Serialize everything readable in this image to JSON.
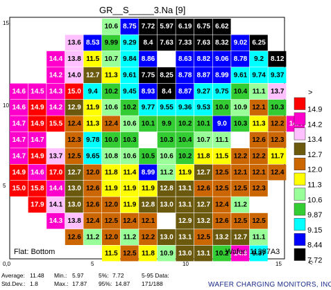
{
  "chart_data": {
    "type": "heatmap",
    "title": "GR__S_____3.Na    [9]",
    "xlim": [
      0,
      15
    ],
    "ylim": [
      0,
      15
    ],
    "x_ticks": [
      "0,0",
      "5",
      "10",
      "15"
    ],
    "y_ticks": [
      "15",
      "10",
      "5"
    ],
    "grid": false,
    "flat_label": "Flat: Bottom",
    "wafer_label": "Wafer: 11387A3",
    "legend": {
      "placement": "right",
      "top_marker": ">",
      "bottom_marker": "<",
      "bins": [
        {
          "label": "14.9",
          "color": "#ff0000"
        },
        {
          "label": "14.2",
          "color": "#ff00cc"
        },
        {
          "label": "13.4",
          "color": "#ffc0ff"
        },
        {
          "label": "12.7",
          "color": "#6b5a0e"
        },
        {
          "label": "12.0",
          "color": "#cc6600"
        },
        {
          "label": "11.3",
          "color": "#ffff00"
        },
        {
          "label": "10.6",
          "color": "#99ff99"
        },
        {
          "label": "9.87",
          "color": "#33cc33"
        },
        {
          "label": "9.15",
          "color": "#00ffff"
        },
        {
          "label": "8.44",
          "color": "#0000ff"
        },
        {
          "label": "7.72",
          "color": "#000000"
        }
      ]
    },
    "rows": [
      {
        "start": 5,
        "values": [
          "10.6",
          "8.75",
          "7.72",
          "5.97",
          "6.19",
          "6.75",
          "6.62"
        ]
      },
      {
        "start": 3,
        "values": [
          "13.6",
          "8.53",
          "9.99",
          "9.29",
          "8.4",
          "7.63",
          "7.33",
          "7.63",
          "8.32",
          "9.02",
          "6.25"
        ]
      },
      {
        "start": 2,
        "values": [
          "14.4",
          "13.8",
          "11.5",
          "10.7",
          "9.84",
          "8.86",
          "",
          "8.63",
          "8.82",
          "9.06",
          "8.78",
          "9.2",
          "8.12"
        ]
      },
      {
        "start": 2,
        "values": [
          "14.2",
          "14.0",
          "12.7",
          "11.3",
          "9.61",
          "7.75",
          "8.25",
          "8.78",
          "8.87",
          "8.99",
          "9.61",
          "9.74",
          "9.37"
        ]
      },
      {
        "start": 0,
        "values": [
          "14.6",
          "14.5",
          "14.3",
          "15.0",
          "9.4",
          "10.2",
          "9.45",
          "8.93",
          "8.4",
          "8.87",
          "9.27",
          "9.75",
          "10.4",
          "11.1",
          "13.7"
        ]
      },
      {
        "start": 0,
        "values": [
          "14.6",
          "14.9",
          "14.2",
          "12.9",
          "11.9",
          "10.6",
          "10.2",
          "9.77",
          "9.55",
          "9.36",
          "9.53",
          "10.0",
          "10.9",
          "12.1",
          "10.3"
        ]
      },
      {
        "start": 0,
        "values": [
          "14.7",
          "14.9",
          "15.5",
          "12.4",
          "11.3",
          "12.4",
          "10.6",
          "10.1",
          "9.9",
          "10.2",
          "10.1",
          "9.0",
          "10.3",
          "11.3",
          "12.2",
          "14.4"
        ]
      },
      {
        "start": 0,
        "values": [
          "14.7",
          "14.7",
          "",
          "12.3",
          "9.78",
          "10.0",
          "10.3",
          "",
          "10.3",
          "10.4",
          "10.7",
          "11.1",
          "",
          "12.6",
          "12.3"
        ]
      },
      {
        "start": 0,
        "values": [
          "14.7",
          "14.9",
          "13.7",
          "12.5",
          "9.65",
          "10.8",
          "10.6",
          "10.5",
          "10.6",
          "10.2",
          "11.8",
          "11.5",
          "12.2",
          "12.2",
          "11.7"
        ]
      },
      {
        "start": 0,
        "values": [
          "14.9",
          "14.6",
          "17.0",
          "12.7",
          "12.0",
          "11.8",
          "11.4",
          "8.99",
          "11.2",
          "11.9",
          "12.7",
          "12.5",
          "12.1",
          "12.1",
          "12.4"
        ]
      },
      {
        "start": 0,
        "values": [
          "15.0",
          "15.8",
          "14.4",
          "13.0",
          "12.6",
          "11.9",
          "11.9",
          "11.9",
          "12.8",
          "13.1",
          "12.6",
          "12.5",
          "12.5",
          "12.3"
        ]
      },
      {
        "start": 1,
        "values": [
          "17.9",
          "14.1",
          "13.0",
          "12.6",
          "12.0",
          "11.9",
          "12.8",
          "13.0",
          "13.1",
          "12.7",
          "12.4",
          "11.2"
        ]
      },
      {
        "start": 2,
        "values": [
          "14.3",
          "13.8",
          "12.4",
          "12.5",
          "12.4",
          "12.1",
          "",
          "12.9",
          "13.2",
          "12.6",
          "12.5",
          "12.5"
        ]
      },
      {
        "start": 3,
        "values": [
          "12.6",
          "11.2",
          "12.0",
          "11.2",
          "12.2",
          "13.0",
          "13.1",
          "12.5",
          "13.2",
          "12.7",
          "11.1"
        ]
      },
      {
        "start": 5,
        "values": [
          "11.5",
          "12.5",
          "11.8",
          "10.9",
          "13.0",
          "13.1",
          "10.2",
          "14.5",
          "9.37"
        ]
      }
    ],
    "stats": {
      "average": "11.48",
      "std_dev": "1.8",
      "min": "5.97",
      "max": "17.87",
      "p5": "7.72",
      "p95": "14.87",
      "data_5_95": "171/188"
    }
  },
  "labels": {
    "average": "Average:",
    "std_dev": "Std.Dev.:",
    "min": "Min.:",
    "max": "Max.:",
    "p5": "5%:",
    "p95": "95%:",
    "data_5_95": "5-95 Data:"
  },
  "company": "WAFER CHARGING MONITORS, INC."
}
